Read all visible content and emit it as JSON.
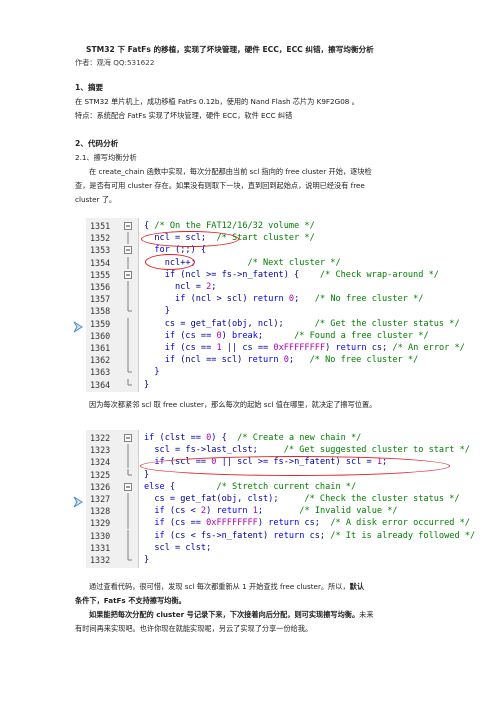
{
  "doc": {
    "title": "STM32 下 FatFs 的移植，实现了坏块管理，硬件 ECC，ECC 纠错，擦写均衡分析",
    "author": "作者：观海    QQ:531622",
    "s1_heading": "1、摘要",
    "s1_line1": "在 STM32 单片机上，成功移植 FatFs 0.12b，使用的 Nand Flash 芯片为   K9F2G08  。",
    "s1_line2": "特点：系统配合 FatFs 实现了坏块管理，硬件 ECC，软件 ECC 纠错",
    "s2_heading": "2、代码分析",
    "s21_heading": "2.1、擦写均衡分析",
    "p1_line1": "在 create_chain 函数中实现，每次分配都由当前 scl 指向的 free cluster 开始，逐块检",
    "p1_line2": "查，是否有可用 cluster 存在。如果没有则取下一块，直到回到起始点，说明已经没有 free",
    "p1_line3": "cluster 了。",
    "p2_line1": "因为每次都紧邻 scl 取 free cluster，那么每次的起始 scl 值在哪里，就决定了擦写位置。",
    "p3_line1a": "通过查看代码，很可惜，发现 scl 每次都重新从 1 开始查找 free cluster。所以，",
    "p3_line1b": "默认",
    "p3_line2": "条件下，FatFs 不支持擦写均衡。",
    "p4_line1a": "如果能把每次分配的 cluster 号记录下来，下次接着向后分配，则可实现擦写均衡。",
    "p4_line1b": "未来",
    "p4_line2": "有时间再来实现吧。也许你现在就能实现呢，另云了实现了分享一份给我。"
  },
  "code1": {
    "lines": [
      {
        "n": "1351",
        "fold": "minus",
        "segs": [
          [
            "",
            "{ "
          ],
          [
            "cm",
            "/* On the FAT12/16/32 volume */"
          ]
        ]
      },
      {
        "n": "1352",
        "fold": "bar",
        "segs": [
          [
            "",
            "  ncl = scl;  "
          ],
          [
            "cm",
            "/* Start cluster */"
          ]
        ]
      },
      {
        "n": "1353",
        "fold": "minus",
        "segs": [
          [
            "kw",
            "  for"
          ],
          [
            "",
            " (;;) {"
          ]
        ]
      },
      {
        "n": "1354",
        "fold": "bar",
        "segs": [
          [
            "",
            "    ncl++;          "
          ],
          [
            "cm",
            "/* Next cluster */"
          ]
        ]
      },
      {
        "n": "1355",
        "fold": "minus",
        "segs": [
          [
            "kw",
            "    if"
          ],
          [
            "",
            " (ncl >= fs->n_fatent) {    "
          ],
          [
            "cm",
            "/* Check wrap-around */"
          ]
        ]
      },
      {
        "n": "1356",
        "fold": "bar",
        "segs": [
          [
            "",
            "      ncl = "
          ],
          [
            "num",
            "2"
          ],
          [
            "",
            ";"
          ]
        ]
      },
      {
        "n": "1357",
        "fold": "bar",
        "segs": [
          [
            "kw",
            "      if"
          ],
          [
            "",
            " (ncl > scl) "
          ],
          [
            "kw",
            "return"
          ],
          [
            "",
            " "
          ],
          [
            "num",
            "0"
          ],
          [
            "",
            ";   "
          ],
          [
            "cm",
            "/* No free cluster */"
          ]
        ]
      },
      {
        "n": "1358",
        "fold": "end",
        "segs": [
          [
            "",
            "    }"
          ]
        ]
      },
      {
        "n": "1359",
        "fold": "bar",
        "segs": [
          [
            "",
            "    cs = get_fat(obj, ncl);      "
          ],
          [
            "cm",
            "/* Get the cluster status */"
          ]
        ]
      },
      {
        "n": "1360",
        "fold": "bar",
        "segs": [
          [
            "kw",
            "    if"
          ],
          [
            "",
            " (cs == "
          ],
          [
            "num",
            "0"
          ],
          [
            "",
            ") "
          ],
          [
            "kw",
            "break"
          ],
          [
            "",
            ";      "
          ],
          [
            "cm",
            "/* Found a free cluster */"
          ]
        ]
      },
      {
        "n": "1361",
        "fold": "bar",
        "segs": [
          [
            "kw",
            "    if"
          ],
          [
            "",
            " (cs == "
          ],
          [
            "num",
            "1"
          ],
          [
            "",
            " || cs == "
          ],
          [
            "num",
            "0xFFFFFFFF"
          ],
          [
            "",
            ") "
          ],
          [
            "kw",
            "return"
          ],
          [
            "",
            " cs; "
          ],
          [
            "cm",
            "/* An error */"
          ]
        ]
      },
      {
        "n": "1362",
        "fold": "bar",
        "segs": [
          [
            "kw",
            "    if"
          ],
          [
            "",
            " (ncl == scl) "
          ],
          [
            "kw",
            "return"
          ],
          [
            "",
            " "
          ],
          [
            "num",
            "0"
          ],
          [
            "",
            ";   "
          ],
          [
            "cm",
            "/* No free cluster */"
          ]
        ]
      },
      {
        "n": "1363",
        "fold": "end",
        "segs": [
          [
            "",
            "  }"
          ]
        ]
      },
      {
        "n": "1364",
        "fold": "end",
        "segs": [
          [
            "",
            "}"
          ]
        ]
      }
    ]
  },
  "code2": {
    "lines": [
      {
        "n": "1322",
        "fold": "minus",
        "segs": [
          [
            "kw",
            "if"
          ],
          [
            "",
            " (clst == "
          ],
          [
            "num",
            "0"
          ],
          [
            "",
            ") {  "
          ],
          [
            "cm",
            "/* Create a new chain */"
          ]
        ]
      },
      {
        "n": "1323",
        "fold": "bar",
        "segs": [
          [
            "",
            "  scl = fs->last_clst;     "
          ],
          [
            "cm",
            "/* Get suggested cluster to start */"
          ]
        ]
      },
      {
        "n": "1324",
        "fold": "bar",
        "segs": [
          [
            "kw",
            "  if"
          ],
          [
            "",
            " (scl == "
          ],
          [
            "num",
            "0"
          ],
          [
            "",
            " || scl >= fs->n_fatent) scl = "
          ],
          [
            "num",
            "1"
          ],
          [
            "",
            ";"
          ]
        ]
      },
      {
        "n": "1325",
        "fold": "end",
        "segs": [
          [
            "",
            "}"
          ]
        ]
      },
      {
        "n": "1326",
        "fold": "minus",
        "segs": [
          [
            "kw",
            "else"
          ],
          [
            "",
            " {        "
          ],
          [
            "cm",
            "/* Stretch current chain */"
          ]
        ]
      },
      {
        "n": "1327",
        "fold": "bar",
        "segs": [
          [
            "",
            "  cs = get_fat(obj, clst);     "
          ],
          [
            "cm",
            "/* Check the cluster status */"
          ]
        ]
      },
      {
        "n": "1328",
        "fold": "bar",
        "segs": [
          [
            "kw",
            "  if"
          ],
          [
            "",
            " (cs < "
          ],
          [
            "num",
            "2"
          ],
          [
            "",
            ") "
          ],
          [
            "kw",
            "return"
          ],
          [
            "",
            " "
          ],
          [
            "num",
            "1"
          ],
          [
            "",
            ";       "
          ],
          [
            "cm",
            "/* Invalid value */"
          ]
        ]
      },
      {
        "n": "1329",
        "fold": "bar",
        "segs": [
          [
            "kw",
            "  if"
          ],
          [
            "",
            " (cs == "
          ],
          [
            "num",
            "0xFFFFFFFF"
          ],
          [
            "",
            ") "
          ],
          [
            "kw",
            "return"
          ],
          [
            "",
            " cs;  "
          ],
          [
            "cm",
            "/* A disk error occurred */"
          ]
        ]
      },
      {
        "n": "1330",
        "fold": "bar",
        "segs": [
          [
            "kw",
            "  if"
          ],
          [
            "",
            " (cs < fs->n_fatent) "
          ],
          [
            "kw",
            "return"
          ],
          [
            "",
            " cs; "
          ],
          [
            "cm",
            "/* It is already followed */"
          ]
        ]
      },
      {
        "n": "1331",
        "fold": "bar",
        "segs": [
          [
            "",
            "  scl = clst;"
          ]
        ]
      },
      {
        "n": "1332",
        "fold": "end",
        "segs": [
          [
            "",
            "}"
          ]
        ]
      }
    ]
  }
}
